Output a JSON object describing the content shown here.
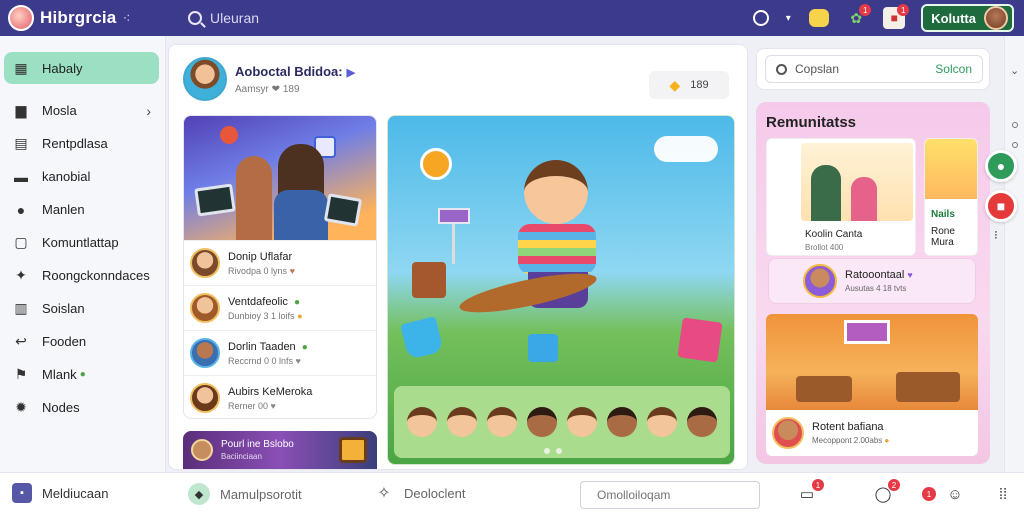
{
  "app": {
    "name": "Hibrgrcia",
    "search_placeholder": "Uleuran"
  },
  "topbar": {
    "profile_name": "Kolutta",
    "badges": {
      "reactions": "1",
      "notifications": "1"
    }
  },
  "sidebar": {
    "items": [
      {
        "label": "Habaly",
        "icon": "grid-icon",
        "active": true
      },
      {
        "label": "Mosla",
        "icon": "folder-icon",
        "chevron": true
      },
      {
        "label": "Rentpdlasa",
        "icon": "calendar-icon"
      },
      {
        "label": "kanobial",
        "icon": "card-icon"
      },
      {
        "label": "Manlen",
        "icon": "user-icon"
      },
      {
        "label": "Komuntlattap",
        "icon": "chat-icon"
      },
      {
        "label": "Roongckonndaces",
        "icon": "pin-icon"
      },
      {
        "label": "Soislan",
        "icon": "book-icon"
      },
      {
        "label": "Fooden",
        "icon": "hook-icon"
      },
      {
        "label": "Mlank",
        "icon": "flag-icon",
        "leaf": true
      },
      {
        "label": "Nodes",
        "icon": "gear-icon"
      }
    ]
  },
  "feed": {
    "author": "Aoboctal Bdidoa:",
    "meta": "Aamsyr ❤ 189",
    "action_count": "189",
    "contacts": [
      {
        "name": "Donip Uflafar",
        "sub": "Rivodpa 0 lyns",
        "avatar_color": "#e8a15a"
      },
      {
        "name": "Ventdafeolic",
        "sub": "Dunbioy 3 1 loifs",
        "avatar_color": "#f2b65a"
      },
      {
        "name": "Dorlin Taaden",
        "sub": "Reccrnd 0 0 lnfs",
        "avatar_color": "#5ab3e6"
      },
      {
        "name": "Aubirs KeMeroka",
        "sub": "Rerner 00",
        "avatar_color": "#f1c060"
      }
    ],
    "promo": {
      "title": "Pourl ine Bslobo",
      "sub": "Baciinciaan"
    }
  },
  "right": {
    "search_placeholder": "Copslan",
    "search_button": "Solcon",
    "panel_title": "Remunitatss",
    "card1": {
      "name": "Koolin Canta",
      "sub": "Brollot 400"
    },
    "card2": {
      "tag": "Nails",
      "name": "Rone Mura"
    },
    "notice": {
      "title": "Ratooontaal",
      "sub": "Ausutas 4 18 tvts"
    },
    "card3": {
      "name": "Rotent bafiana",
      "sub": "Mecoppont 2.00abs"
    }
  },
  "bottombar": {
    "item1": "Meldiucaan",
    "item2": "Mamulpsorotit",
    "item3": "Deoloclent",
    "input_placeholder": "Omolloiloqam",
    "badge1": "1",
    "badge2": "2",
    "badge3": "1"
  },
  "colors": {
    "accent": "#3c3a8a",
    "active_item": "#9be0c2",
    "panel": "#f6c9ea"
  }
}
